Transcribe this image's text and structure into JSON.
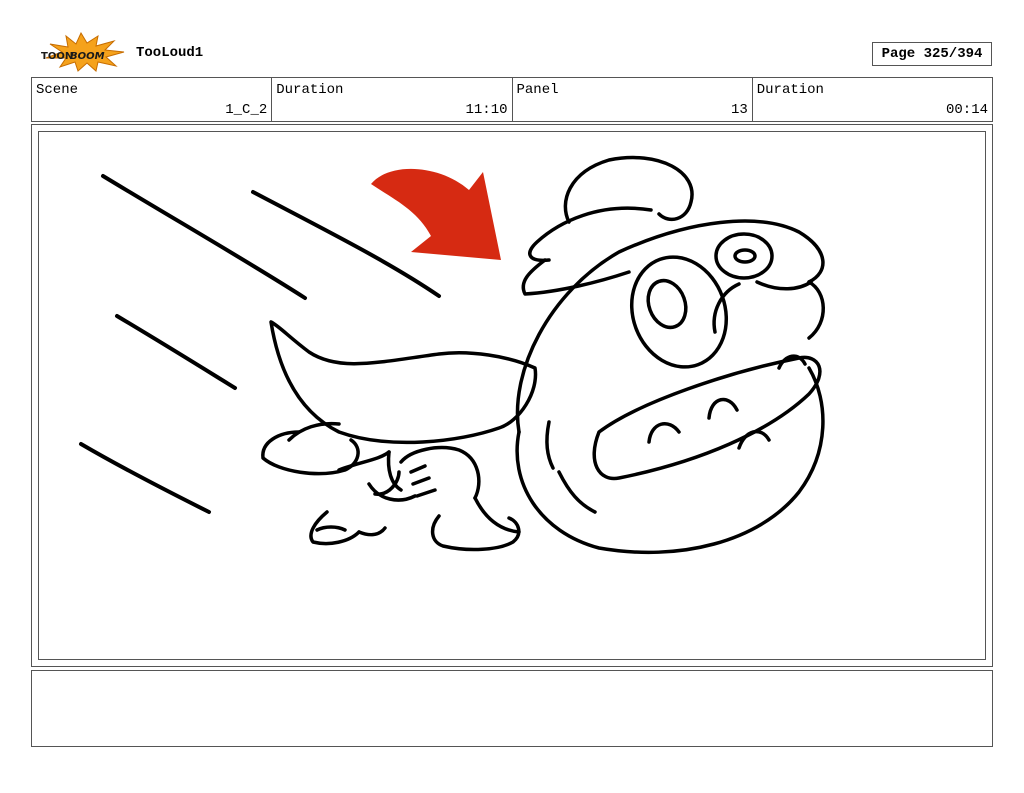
{
  "header": {
    "logo_text": "TOONBOOM",
    "project_title": "TooLoud1",
    "page_label": "Page 325/394"
  },
  "info_bar": [
    {
      "label": "Scene",
      "value": "1_C_2"
    },
    {
      "label": "Duration",
      "value": "11:10"
    },
    {
      "label": "Panel",
      "value": "13"
    },
    {
      "label": "Duration",
      "value": "00:14"
    }
  ],
  "panel": {
    "accent_color": "#d62a12",
    "arrow_icon": "curved-arrow-icon",
    "drawing_subject": "character-sketch"
  },
  "notes": {
    "text": ""
  }
}
